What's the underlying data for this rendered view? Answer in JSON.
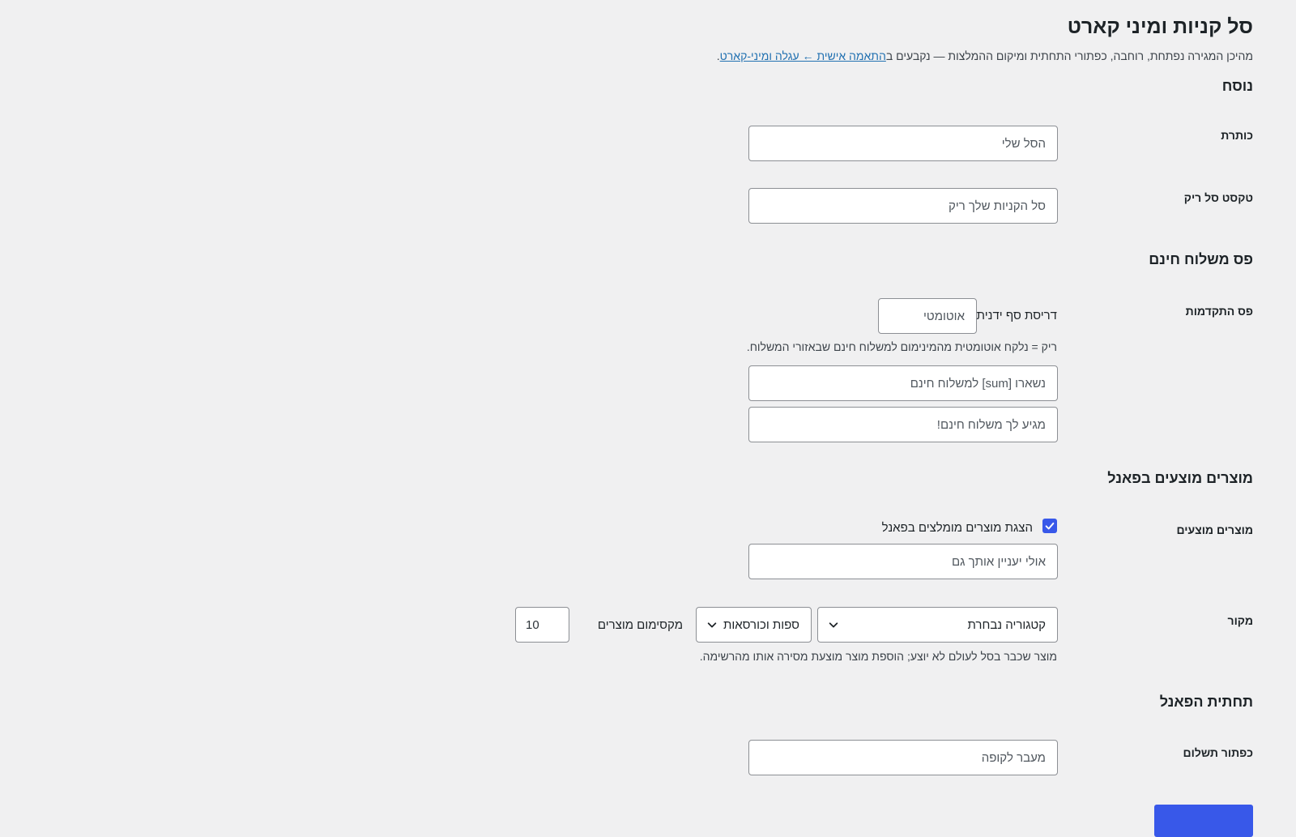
{
  "page": {
    "title": "סל קניות ומיני קארט",
    "intro_before": "מהיכן המגירה נפתחת, רוחבה, כפתורי התחתית ומיקום ההמלצות — נקבעים ב",
    "intro_link": "התאמה אישית ← עגלה ומיני-קארט",
    "intro_after": "."
  },
  "copy": {
    "heading": "נוסח",
    "title_label": "כותרת",
    "title_placeholder": "הסל שלי",
    "empty_label": "טקסט סל ריק",
    "empty_placeholder": "סל הקניות שלך ריק"
  },
  "free_shipping": {
    "heading": "פס משלוח חינם",
    "progress_label": "פס התקדמות",
    "threshold_label": "דריסת סף ידנית",
    "threshold_placeholder": "אוטומטי",
    "threshold_hint": "ריק = נלקח אוטומטית מהמינימום למשלוח חינם שבאזורי המשלוח.",
    "remaining_placeholder": "נשארו [sum] למשלוח חינם",
    "reached_placeholder": "מגיע לך משלוח חינם!"
  },
  "suggested": {
    "heading": "מוצרים מוצעים בפאנל",
    "label": "מוצרים מוצעים",
    "checkbox_label": "הצגת מוצרים מומלצים בפאנל",
    "checkbox_checked": true,
    "title_placeholder": "אולי יעניין אותך גם",
    "source_label": "מקור",
    "source_select": "קטגוריה נבחרת",
    "category_select": "ספות וכורסאות",
    "max_label": "מקסימום מוצרים",
    "max_value": "10",
    "hint": "מוצר שכבר בסל לעולם לא יוצע; הוספת מוצר מוצעת מסירה אותו מהרשימה."
  },
  "footer": {
    "heading": "תחתית הפאנל",
    "checkout_label": "כפתור תשלום",
    "checkout_placeholder": "מעבר לקופה"
  },
  "colors": {
    "accent": "#3858e9",
    "link": "#2271b1",
    "background": "#f0f0f1"
  },
  "icons": {
    "select_arrow": "chevron-down-icon",
    "checkbox_mark": "checkmark-icon"
  }
}
